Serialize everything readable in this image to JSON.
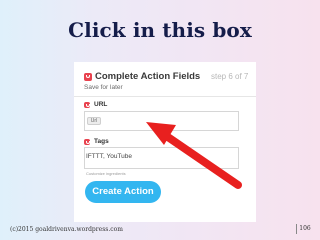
{
  "slide": {
    "title": "Click in this box",
    "footer": "(c)2015 goaldrivenva.wordpress.com",
    "page_number": "106"
  },
  "form": {
    "header_title": "Complete Action Fields",
    "step": "step 6 of 7",
    "save_for_later": "Save for later",
    "url_label": "URL",
    "url_chip": "Url",
    "tags_label": "Tags",
    "tags_value": "IFTTT, YouTube",
    "custom_ingredients": "Customize ingredients",
    "create_button": "Create Action"
  },
  "colors": {
    "title": "#151d4a",
    "button": "#33b6f0",
    "icon": "#e8424e",
    "arrow": "#e8201f"
  },
  "icons": [
    "pocket-icon",
    "red-arrow-icon"
  ]
}
